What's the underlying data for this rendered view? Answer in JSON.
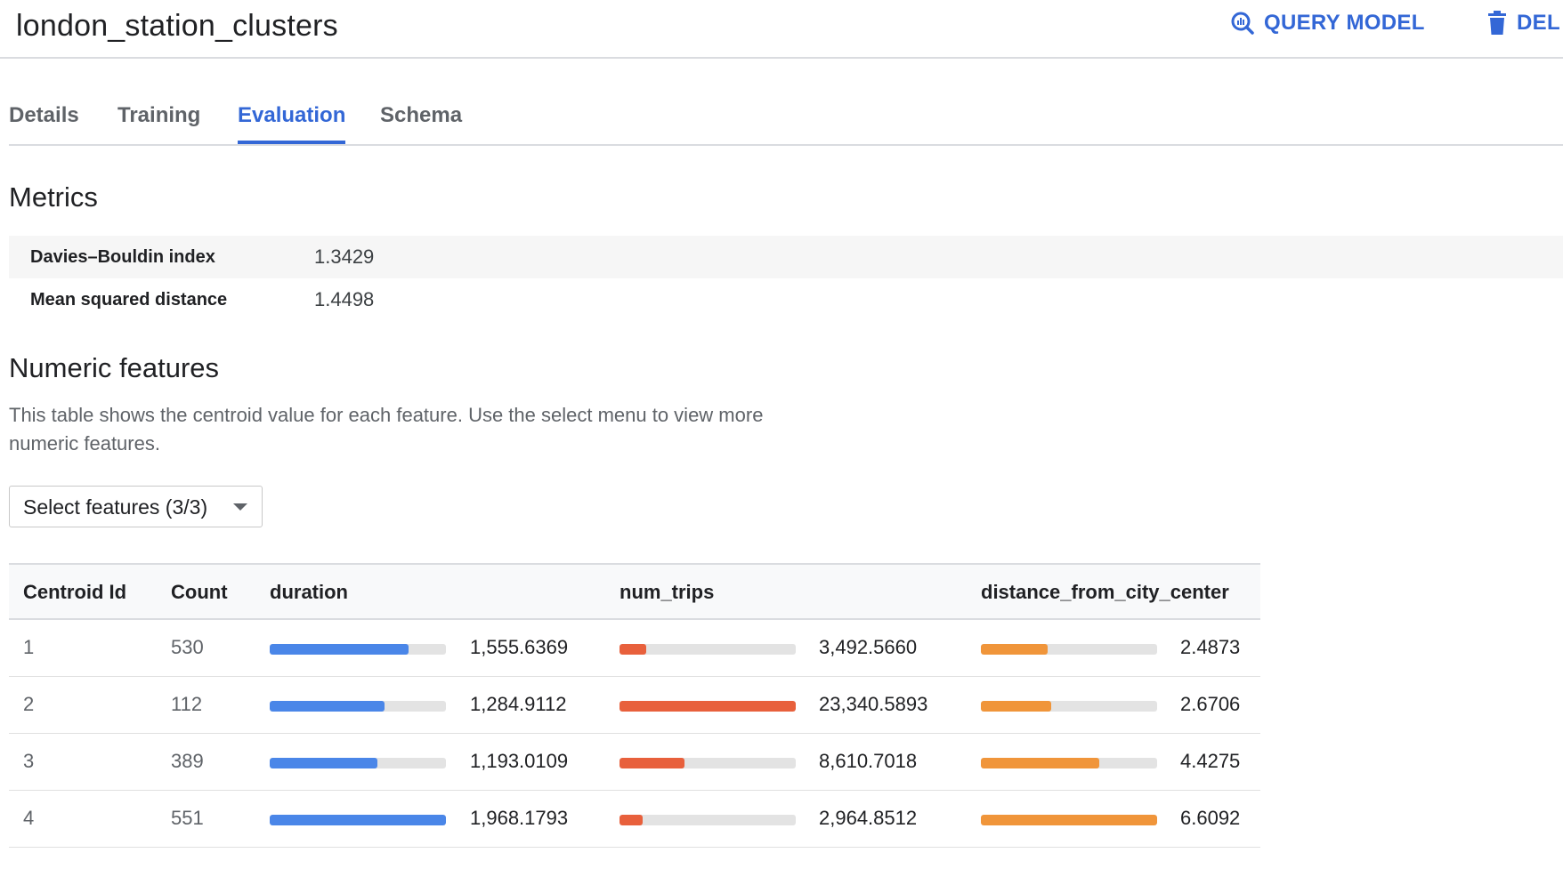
{
  "header": {
    "title": "london_station_clusters",
    "query_model_label": "QUERY MODEL",
    "delete_label": "DEL"
  },
  "tabs": [
    {
      "label": "Details",
      "active": false
    },
    {
      "label": "Training",
      "active": false
    },
    {
      "label": "Evaluation",
      "active": true
    },
    {
      "label": "Schema",
      "active": false
    }
  ],
  "metrics": {
    "title": "Metrics",
    "rows": [
      {
        "label": "Davies–Bouldin index",
        "value": "1.3429"
      },
      {
        "label": "Mean squared distance",
        "value": "1.4498"
      }
    ]
  },
  "numeric_features": {
    "title": "Numeric features",
    "description": "This table shows the centroid value for each feature. Use the select menu to view more numeric features.",
    "select_label": "Select features (3/3)"
  },
  "table": {
    "columns": [
      "Centroid Id",
      "Count",
      "duration",
      "num_trips",
      "distance_from_city_center"
    ],
    "rows": [
      {
        "id": "1",
        "count": "530",
        "duration": "1,555.6369",
        "num_trips": "3,492.5660",
        "distance": "2.4873"
      },
      {
        "id": "2",
        "count": "112",
        "duration": "1,284.9112",
        "num_trips": "23,340.5893",
        "distance": "2.6706"
      },
      {
        "id": "3",
        "count": "389",
        "duration": "1,193.0109",
        "num_trips": "8,610.7018",
        "distance": "4.4275"
      },
      {
        "id": "4",
        "count": "551",
        "duration": "1,968.1793",
        "num_trips": "2,964.8512",
        "distance": "6.6092"
      }
    ],
    "bar_fill_fractions": {
      "duration": [
        0.79,
        0.65,
        0.61,
        1.0
      ],
      "num_trips": [
        0.15,
        1.0,
        0.37,
        0.13
      ],
      "distance": [
        0.38,
        0.4,
        0.67,
        1.0
      ]
    }
  },
  "colors": {
    "accent": "#3367d6",
    "duration_bar": "#4a86e8",
    "num_trips_bar": "#e8603c",
    "distance_bar": "#f0953a",
    "bar_track": "#e3e3e3"
  }
}
